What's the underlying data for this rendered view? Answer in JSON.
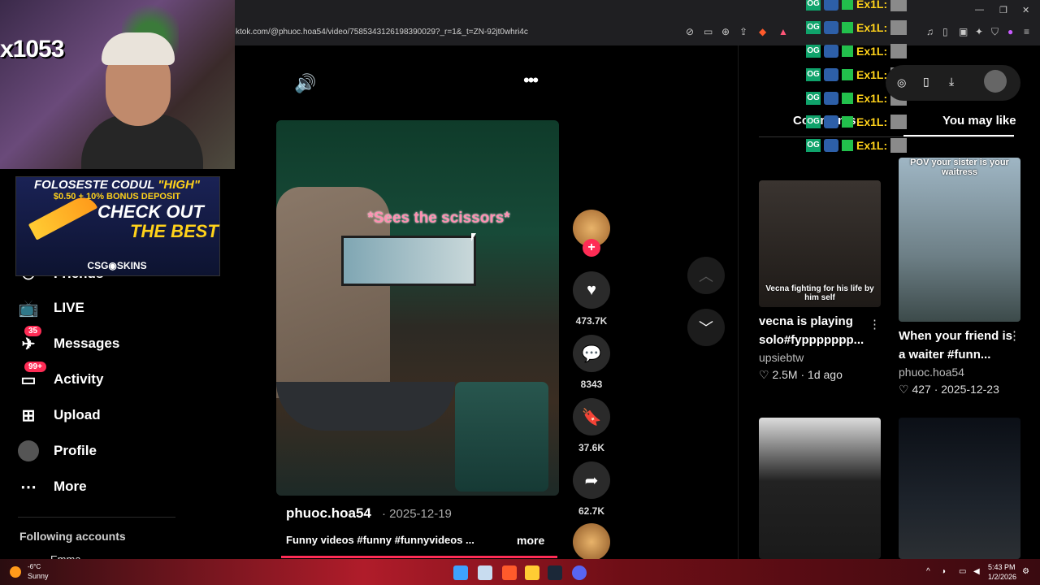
{
  "browser": {
    "url": "ktok.com/@phuoc.hoa54/video/7585343126198390029?_r=1&_t=ZN-92jt0whri4c"
  },
  "sidebar": {
    "items": [
      {
        "label": "Friends",
        "icon": "friends-icon"
      },
      {
        "label": "LIVE",
        "icon": "live-icon"
      },
      {
        "label": "Messages",
        "icon": "messages-icon",
        "badge": "35"
      },
      {
        "label": "Activity",
        "icon": "activity-icon",
        "badge": "99+"
      },
      {
        "label": "Upload",
        "icon": "upload-icon"
      },
      {
        "label": "Profile",
        "icon": "profile-icon"
      },
      {
        "label": "More",
        "icon": "more-icon"
      }
    ],
    "following_title": "Following accounts",
    "following_first": "Emma"
  },
  "video": {
    "caption_overlay": "*Sees the scissors*",
    "author": "phuoc.hoa54",
    "date": "2025-12-19",
    "description": "Funny videos #funny #funnyvideos ...",
    "more_label": "more",
    "likes": "473.7K",
    "comments": "8343",
    "saves": "37.6K",
    "shares": "62.7K"
  },
  "right_panel": {
    "tab_comments": "Comments",
    "tab_you_may_like": "You may like",
    "cards": [
      {
        "thumb_text": "Vecna fighting for his life by him self",
        "title": "vecna is playing solo#fyppppppp...",
        "author": "upsiebtw",
        "likes": "2.5M",
        "age": "1d ago"
      },
      {
        "thumb_text": "POV your sister is your waitress",
        "title": "When your friend is a waiter #funn...",
        "author": "phuoc.hoa54",
        "likes": "427",
        "age": "2025-12-23"
      },
      {
        "thumb_text": "",
        "title": "",
        "author": "",
        "likes": "",
        "age": ""
      },
      {
        "thumb_text": "",
        "title": "",
        "author": "",
        "likes": "",
        "age": ""
      }
    ]
  },
  "overlays": {
    "webcam_counter": "x1053",
    "ad": {
      "line1_a": "FOLOSESTE CODUL ",
      "line1_b": "\"HIGH\"",
      "line2": "$0.50 + 10% BONUS DEPOSIT",
      "line3": "CHECK OUT",
      "line4": "THE BEST",
      "brand": "CSG◉SKINS"
    },
    "chat_text": "Ex1L:",
    "chat_lines": 7
  },
  "taskbar": {
    "temperature": "-6°C",
    "weather": "Sunny",
    "time": "5:43 PM",
    "date": "1/2/2026"
  },
  "colors": {
    "accent": "#fe2c55",
    "chat_yellow": "#ffd21a",
    "background": "#000000"
  }
}
